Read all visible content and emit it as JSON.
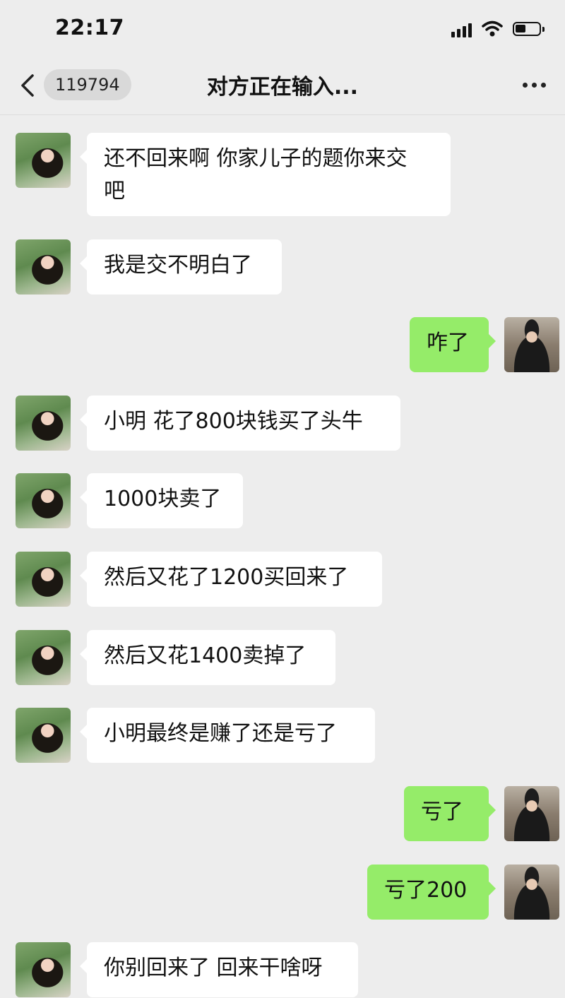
{
  "status_bar": {
    "time": "22:17"
  },
  "nav": {
    "unread_count": "119794",
    "title": "对方正在输入..."
  },
  "messages": [
    {
      "side": "left",
      "text": "还不回来啊 你家儿子的题你来交\n吧"
    },
    {
      "side": "left",
      "text": "我是交不明白了"
    },
    {
      "side": "right",
      "text": "咋了"
    },
    {
      "side": "left",
      "text": "小明 花了800块钱买了头牛"
    },
    {
      "side": "left",
      "text": "1000块卖了"
    },
    {
      "side": "left",
      "text": "然后又花了1200买回来了"
    },
    {
      "side": "left",
      "text": "然后又花1400卖掉了"
    },
    {
      "side": "left",
      "text": "小明最终是赚了还是亏了"
    },
    {
      "side": "right",
      "text": "亏了"
    },
    {
      "side": "right",
      "text": "亏了200"
    },
    {
      "side": "left",
      "text": "你别回来了 回来干啥呀"
    }
  ],
  "colors": {
    "background": "#ededed",
    "outgoing_bubble": "#95ec69",
    "incoming_bubble": "#ffffff"
  }
}
